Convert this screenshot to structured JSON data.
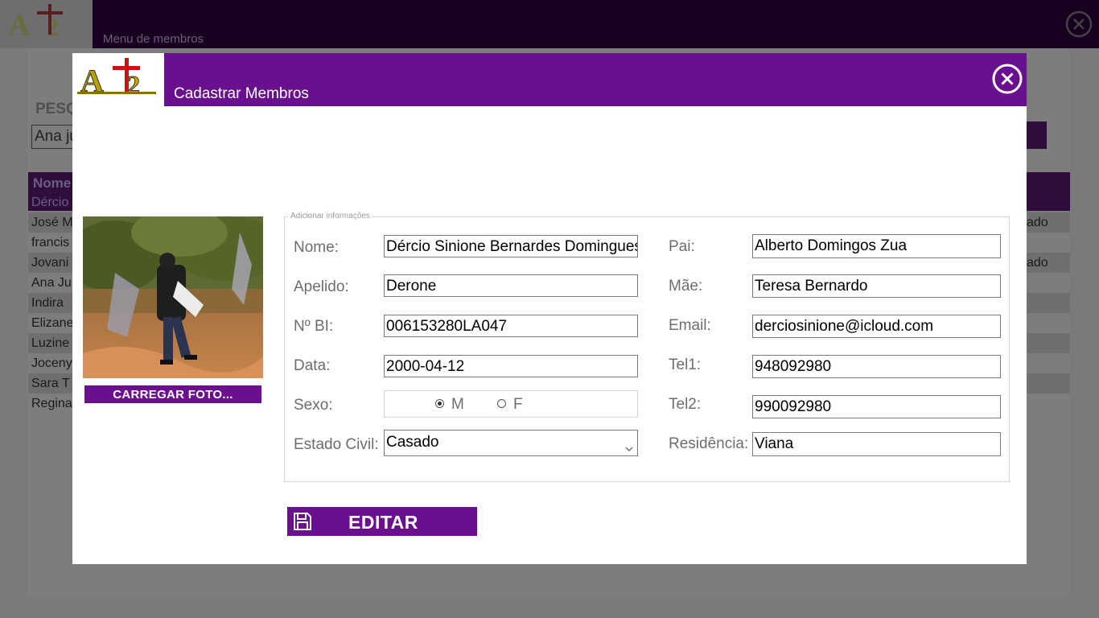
{
  "app": {
    "menu_title": "Menu de membros",
    "search_label": "PESQ",
    "search_value": "Ana ju",
    "table_header": "Nome",
    "selected_row": "Dércio",
    "rows": [
      {
        "name": "José M",
        "right": "ado"
      },
      {
        "name": "francis",
        "right": ""
      },
      {
        "name": "Jovani",
        "right": "ado"
      },
      {
        "name": "Ana Ju",
        "right": ""
      },
      {
        "name": "Indira",
        "right": ""
      },
      {
        "name": "Elizane",
        "right": ""
      },
      {
        "name": "Luzine",
        "right": ""
      },
      {
        "name": "Joceny",
        "right": ""
      },
      {
        "name": "Sara T",
        "right": ""
      },
      {
        "name": "Regina",
        "right": ""
      }
    ]
  },
  "modal": {
    "title": "Cadastrar Membros",
    "legend": "Adicionar informações",
    "upload_button": "CARREGAR FOTO...",
    "edit_button": "EDITAR",
    "fields": {
      "nome": {
        "label": "Nome:",
        "value": "Dércio Sinione Bernardes Domingues"
      },
      "apelido": {
        "label": "Apelido:",
        "value": "Derone"
      },
      "bi": {
        "label": "Nº BI:",
        "value": "006153280LA047"
      },
      "data": {
        "label": "Data:",
        "value": "2000-04-12"
      },
      "sexo": {
        "label": "Sexo:",
        "options": [
          "M",
          "F"
        ],
        "selected": "M"
      },
      "estado_civil": {
        "label": "Estado Civil:",
        "value": "Casado"
      },
      "pai": {
        "label": "Pai:",
        "value": "Alberto Domingos Zua"
      },
      "mae": {
        "label": "Mãe:",
        "value": "Teresa Bernardo"
      },
      "email": {
        "label": "Email:",
        "value": "derciosinione@icloud.com"
      },
      "tel1": {
        "label": "Tel1:",
        "value": "948092980"
      },
      "tel2": {
        "label": "Tel2:",
        "value": "990092980"
      },
      "residencia": {
        "label": "Residência:",
        "value": "Viana"
      }
    }
  },
  "colors": {
    "accent": "#6a0f8e",
    "dark_header": "#17001f"
  },
  "icons": [
    "logo-icon",
    "close-icon",
    "save-icon",
    "chevron-down-icon"
  ]
}
